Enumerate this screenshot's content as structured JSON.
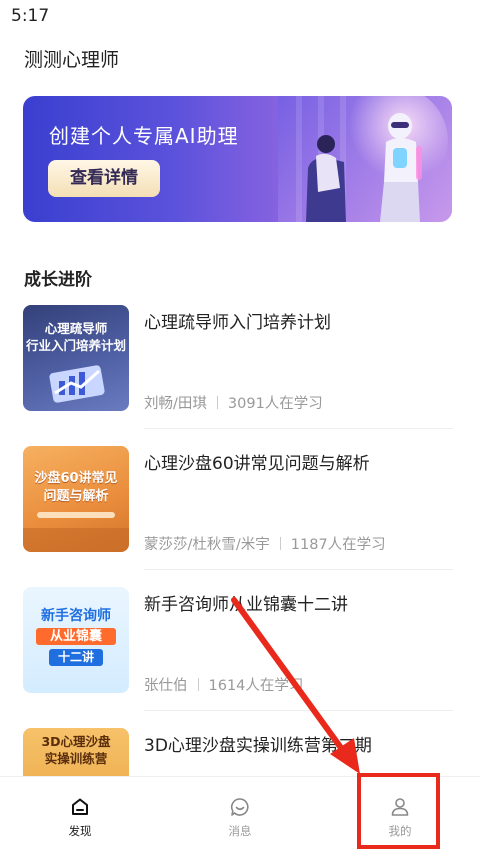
{
  "status": {
    "time": "5:17"
  },
  "app": {
    "title": "测测心理师"
  },
  "banner": {
    "title": "创建个人专属AI助理",
    "button": "查看详情"
  },
  "section": {
    "title": "成长进阶"
  },
  "courses": [
    {
      "title": "心理疏导师入门培养计划",
      "teachers": "刘畅/田琪",
      "learners": "3091人在学习",
      "thumb_text": [
        "心理疏导师",
        "行业入门培养计划"
      ]
    },
    {
      "title": "心理沙盘60讲常见问题与解析",
      "teachers": "蒙莎莎/杜秋雪/米宇",
      "learners": "1187人在学习",
      "thumb_text": [
        "沙盘60讲常见",
        "问题与解析"
      ]
    },
    {
      "title": "新手咨询师从业锦囊十二讲",
      "teachers": "张仕伯",
      "learners": "1614人在学习",
      "thumb_text": [
        "新手咨询师",
        "从业锦囊",
        "十二讲"
      ]
    },
    {
      "title": "3D心理沙盘实操训练营第二期",
      "teachers": "",
      "learners": "",
      "thumb_text": [
        "3D心理沙盘",
        "实操训练营"
      ]
    }
  ],
  "tabs": [
    {
      "label": "发现",
      "icon": "home-icon",
      "active": true
    },
    {
      "label": "消息",
      "icon": "chat-icon",
      "active": false
    },
    {
      "label": "我的",
      "icon": "profile-icon",
      "active": false
    }
  ],
  "colors": {
    "accent": "#e8291c",
    "banner_start": "#3a3fcf",
    "banner_end": "#b489e6"
  }
}
